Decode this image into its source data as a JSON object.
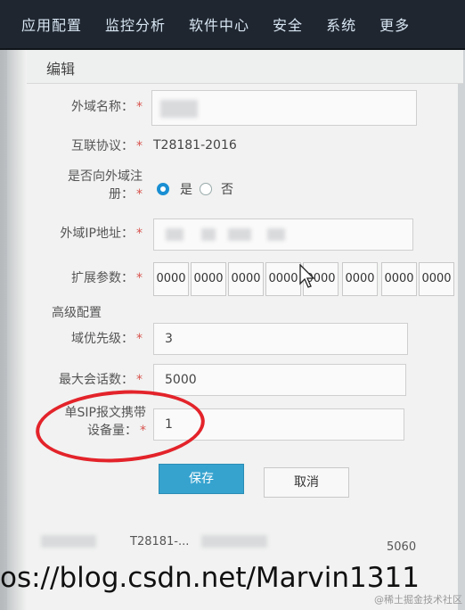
{
  "nav": {
    "items": [
      "应用配置",
      "监控分析",
      "软件中心",
      "安全",
      "系统",
      "更多"
    ]
  },
  "dialog": {
    "title": "编辑",
    "fields": {
      "domain_name": {
        "label": "外域名称：",
        "value": ""
      },
      "protocol": {
        "label": "互联协议：",
        "value": "T28181-2016"
      },
      "register": {
        "label_line1": "是否向外域注",
        "label_line2": "册：",
        "option_yes": "是",
        "option_no": "否",
        "selected": "是"
      },
      "ip": {
        "label": "外域IP地址：",
        "value": ""
      },
      "ext": {
        "label": "扩展参数：",
        "values": [
          "0000",
          "0000",
          "0000",
          "0000",
          "0000",
          "0000",
          "0000",
          "0000"
        ]
      }
    },
    "advanced": {
      "title": "高级配置",
      "priority": {
        "label": "域优先级：",
        "value": "3"
      },
      "max_sessions": {
        "label": "最大会话数：",
        "value": "5000"
      },
      "devices": {
        "label_line1": "单SIP报文携带",
        "label_line2": "设备量：",
        "value": "1"
      }
    },
    "buttons": {
      "save": "保存",
      "cancel": "取消"
    },
    "required_mark": "*"
  },
  "list_row": {
    "protocol": "T28181-...",
    "port": "5060"
  },
  "watermark": {
    "url": "os://blog.csdn.net/Marvin1311",
    "small": "@稀土掘金技术社区"
  },
  "colors": {
    "nav_bg": "#1f2630",
    "primary": "#36a3cf",
    "required": "#d9534f",
    "annotation": "#e3232a"
  }
}
